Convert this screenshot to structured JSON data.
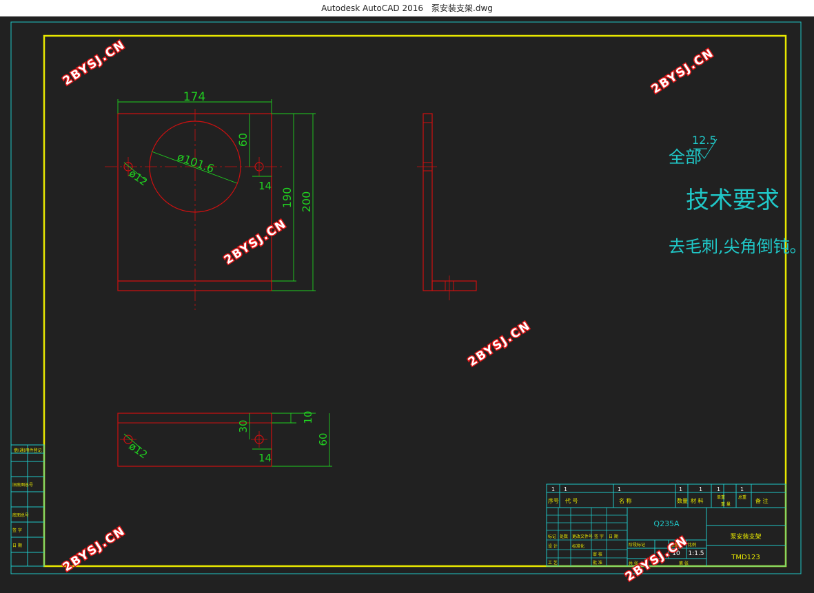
{
  "window": {
    "app_title": "Autodesk AutoCAD 2016",
    "file_name": "泵安装支架.dwg"
  },
  "front_view": {
    "dim_width": "174",
    "dim_hole_top": "60",
    "dim_circle": "ø101.6",
    "dim_hole_left": "ø12",
    "dim_hole_right_offset": "14",
    "dim_190": "190",
    "dim_200": "200"
  },
  "bottom_view": {
    "dim_30": "30",
    "dim_10": "10",
    "dim_60": "60",
    "dim_hole": "ø12",
    "dim_14": "14"
  },
  "notes": {
    "roughness_label": "全部",
    "roughness_value": "12.5",
    "heading": "技术要求",
    "line1": "去毛刺,尖角倒钝。"
  },
  "title_block": {
    "top_nums": [
      "1",
      "1",
      "1",
      "1",
      "1",
      "1",
      "1"
    ],
    "headers": [
      "序号",
      "代   号",
      "名    称",
      "数量",
      "材  料",
      "单重",
      "总重",
      "备  注"
    ],
    "sub_header": "重  量",
    "material": "Q235A",
    "part_name": "泵安装支架",
    "drawing_no": "TMD123",
    "qty": "10",
    "scale": "1:1.5",
    "rows": [
      "标记",
      "处数",
      "更改文件号",
      "签  字",
      "日  期",
      "设  计",
      "标准化",
      "审  核",
      "工  艺",
      "批  准",
      "共  张",
      "第  张",
      "阶段标记",
      "重量",
      "比例"
    ]
  },
  "side_table": {
    "cells": [
      "借(通)用件登记",
      "旧底图总号",
      "底图总号",
      "签  字",
      "日  期"
    ]
  },
  "watermark": "2BYSJ.CN"
}
